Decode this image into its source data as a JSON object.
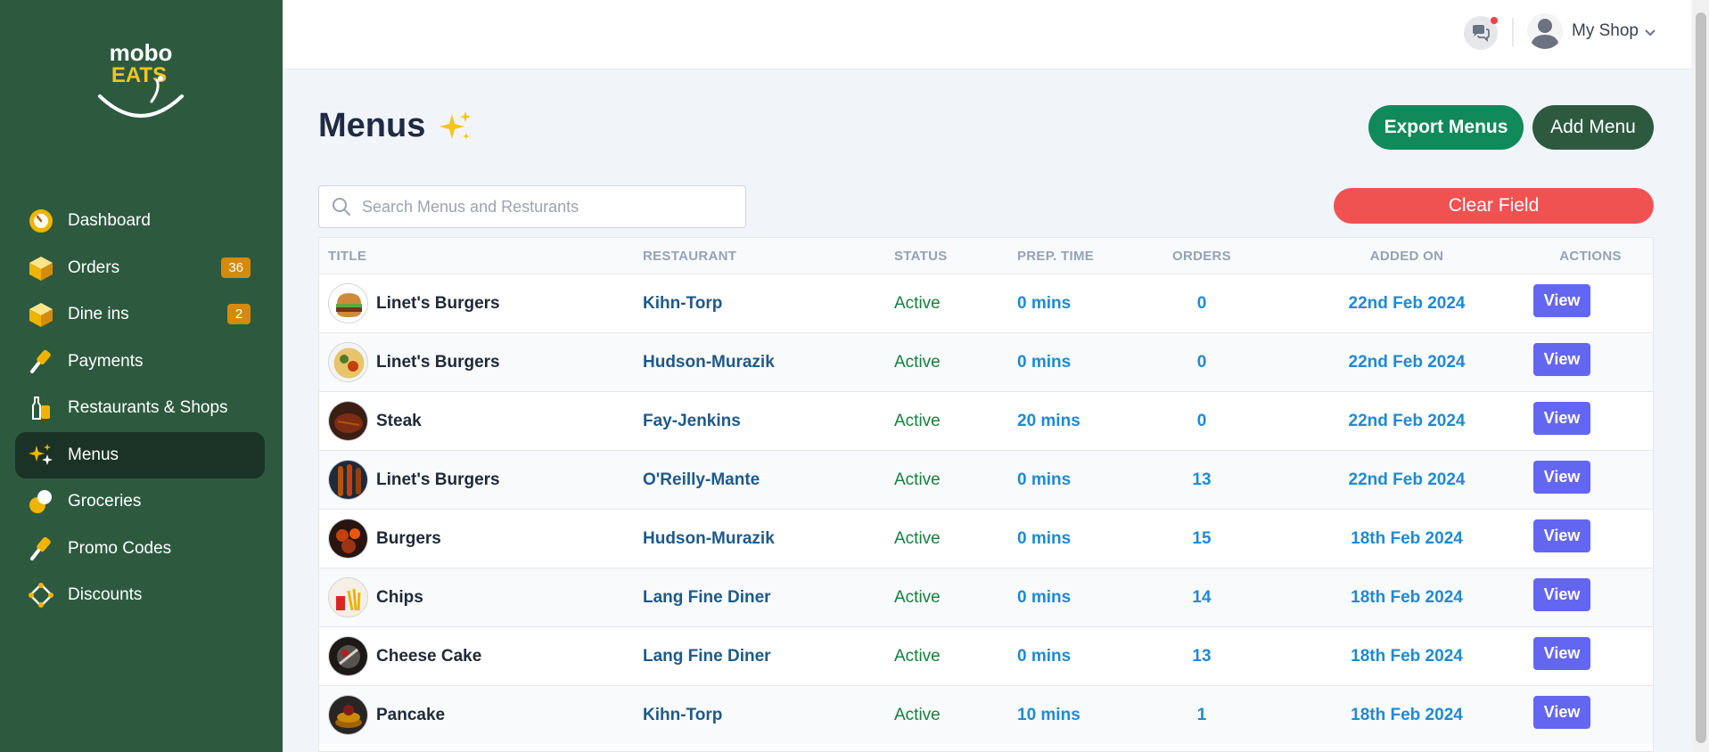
{
  "brand": {
    "line1": "mobo",
    "line2": "EATS"
  },
  "sidebar": {
    "items": [
      {
        "label": "Dashboard",
        "icon": "dashboard-icon"
      },
      {
        "label": "Orders",
        "icon": "box-icon",
        "badge": "36"
      },
      {
        "label": "Dine ins",
        "icon": "box-icon",
        "badge": "2"
      },
      {
        "label": "Payments",
        "icon": "brush-icon"
      },
      {
        "label": "Restaurants & Shops",
        "icon": "bottle-icon"
      },
      {
        "label": "Menus",
        "icon": "sparkle-icon",
        "active": true
      },
      {
        "label": "Groceries",
        "icon": "groceries-icon"
      },
      {
        "label": "Promo Codes",
        "icon": "brush-icon"
      },
      {
        "label": "Discounts",
        "icon": "discount-icon"
      }
    ]
  },
  "topbar": {
    "user_name": "My Shop"
  },
  "page": {
    "title": "Menus",
    "export_label": "Export Menus",
    "add_label": "Add Menu",
    "search_placeholder": "Search Menus and Resturants",
    "clear_label": "Clear Field"
  },
  "table": {
    "headers": [
      "TITLE",
      "RESTAURANT",
      "STATUS",
      "PREP. TIME",
      "ORDERS",
      "ADDED ON",
      "ACTIONS"
    ],
    "view_label": "View",
    "rows": [
      {
        "title": "Linet's Burgers",
        "restaurant": "Kihn-Torp",
        "status": "Active",
        "prep": "0 mins",
        "orders": "0",
        "added": "22nd Feb 2024"
      },
      {
        "title": "Linet's Burgers",
        "restaurant": "Hudson-Murazik",
        "status": "Active",
        "prep": "0 mins",
        "orders": "0",
        "added": "22nd Feb 2024"
      },
      {
        "title": "Steak",
        "restaurant": "Fay-Jenkins",
        "status": "Active",
        "prep": "20 mins",
        "orders": "0",
        "added": "22nd Feb 2024"
      },
      {
        "title": "Linet's Burgers",
        "restaurant": "O'Reilly-Mante",
        "status": "Active",
        "prep": "0 mins",
        "orders": "13",
        "added": "22nd Feb 2024"
      },
      {
        "title": "Burgers",
        "restaurant": "Hudson-Murazik",
        "status": "Active",
        "prep": "0 mins",
        "orders": "15",
        "added": "18th Feb 2024"
      },
      {
        "title": "Chips",
        "restaurant": "Lang Fine Diner",
        "status": "Active",
        "prep": "0 mins",
        "orders": "14",
        "added": "18th Feb 2024"
      },
      {
        "title": "Cheese Cake",
        "restaurant": "Lang Fine Diner",
        "status": "Active",
        "prep": "0 mins",
        "orders": "13",
        "added": "18th Feb 2024"
      },
      {
        "title": "Pancake",
        "restaurant": "Kihn-Torp",
        "status": "Active",
        "prep": "10 mins",
        "orders": "1",
        "added": "18th Feb 2024"
      }
    ]
  },
  "colors": {
    "sidebar_bg": "#2d5a3f",
    "sidebar_active": "#1a3326",
    "accent_gold": "#f0b400",
    "export_button": "#108a5a",
    "clear_button": "#f05252",
    "view_button": "#6366f1",
    "link_blue": "#1d8ad6",
    "status_green": "#15803d"
  }
}
